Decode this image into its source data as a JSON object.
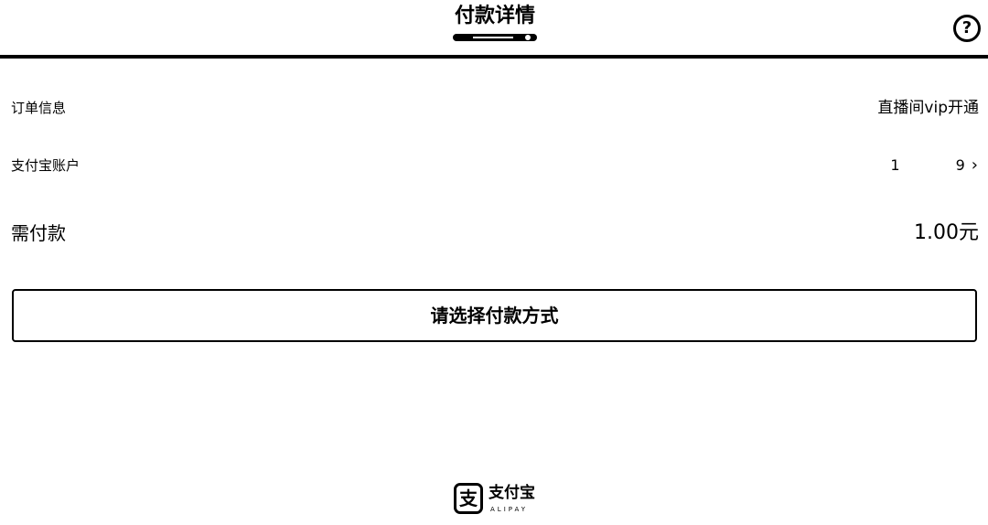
{
  "header": {
    "title": "付款详情",
    "help_icon": "question-circle-icon",
    "help_glyph": "?"
  },
  "order": {
    "label": "订单信息",
    "value": "直播间vip开通"
  },
  "account": {
    "label": "支付宝账户",
    "value_start": "1",
    "value_end": "9",
    "chevron_icon": "chevron-right-icon",
    "chevron_glyph": "›"
  },
  "amount": {
    "label": "需付款",
    "value": "1.00元"
  },
  "pay_button": {
    "label": "请选择付款方式"
  },
  "footer": {
    "logo_icon": "alipay-logo-icon",
    "logo_glyph": "支",
    "brand": "支付宝",
    "brand_en": "ALIPAY"
  }
}
